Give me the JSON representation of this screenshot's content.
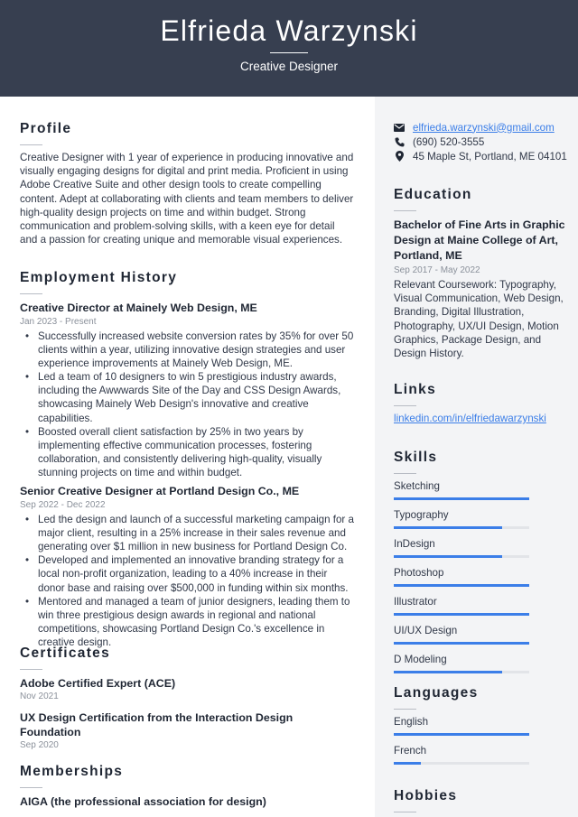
{
  "header": {
    "name": "Elfrieda Warzynski",
    "title": "Creative Designer"
  },
  "profile": {
    "heading": "Profile",
    "text": "Creative Designer with 1 year of experience in producing innovative and visually engaging designs for digital and print media. Proficient in using Adobe Creative Suite and other design tools to create compelling content. Adept at collaborating with clients and team members to deliver high-quality design projects on time and within budget. Strong communication and problem-solving skills, with a keen eye for detail and a passion for creating unique and memorable visual experiences."
  },
  "employment": {
    "heading": "Employment History",
    "jobs": [
      {
        "title": "Creative Director at Mainely Web Design, ME",
        "date": "Jan 2023 - Present",
        "bullets": [
          "Successfully increased website conversion rates by 35% for over 50 clients within a year, utilizing innovative design strategies and user experience improvements at Mainely Web Design, ME.",
          "Led a team of 10 designers to win 5 prestigious industry awards, including the Awwwards Site of the Day and CSS Design Awards, showcasing Mainely Web Design's innovative and creative capabilities.",
          "Boosted overall client satisfaction by 25% in two years by implementing effective communication processes, fostering collaboration, and consistently delivering high-quality, visually stunning projects on time and within budget."
        ]
      },
      {
        "title": "Senior Creative Designer at Portland Design Co., ME",
        "date": "Sep 2022 - Dec 2022",
        "bullets": [
          "Led the design and launch of a successful marketing campaign for a major client, resulting in a 25% increase in their sales revenue and generating over $1 million in new business for Portland Design Co.",
          "Developed and implemented an innovative branding strategy for a local non-profit organization, leading to a 40% increase in their donor base and raising over $500,000 in funding within six months.",
          "Mentored and managed a team of junior designers, leading them to win three prestigious design awards in regional and national competitions, showcasing Portland Design Co.'s excellence in creative design."
        ]
      }
    ]
  },
  "certificates": {
    "heading": "Certificates",
    "items": [
      {
        "title": "Adobe Certified Expert (ACE)",
        "date": "Nov 2021"
      },
      {
        "title": "UX Design Certification from the Interaction Design Foundation",
        "date": "Sep 2020"
      }
    ]
  },
  "memberships": {
    "heading": "Memberships",
    "items": [
      {
        "title": "AIGA (the professional association for design)"
      }
    ]
  },
  "contact": {
    "email": "elfrieda.warzynski@gmail.com",
    "phone": "(690) 520-3555",
    "address": "45 Maple St, Portland, ME 04101",
    "icons": {
      "email": "envelope-icon",
      "phone": "phone-icon",
      "address": "map-pin-icon"
    }
  },
  "education": {
    "heading": "Education",
    "degree": "Bachelor of Fine Arts in Graphic Design at Maine College of Art, Portland, ME",
    "date": "Sep 2017 - May 2022",
    "details": "Relevant Coursework: Typography, Visual Communication, Web Design, Branding, Digital Illustration, Photography, UX/UI Design, Motion Graphics, Package Design, and Design History."
  },
  "links": {
    "heading": "Links",
    "items": [
      {
        "label": "linkedin.com/in/elfriedawarzynski"
      }
    ]
  },
  "skills": {
    "heading": "Skills",
    "items": [
      {
        "name": "Sketching",
        "level_percent": 100
      },
      {
        "name": "Typography",
        "level_percent": 80
      },
      {
        "name": "InDesign",
        "level_percent": 80
      },
      {
        "name": "Photoshop",
        "level_percent": 100
      },
      {
        "name": "Illustrator",
        "level_percent": 100
      },
      {
        "name": "UI/UX Design",
        "level_percent": 100
      },
      {
        "name": "D Modeling",
        "level_percent": 80
      }
    ]
  },
  "languages": {
    "heading": "Languages",
    "items": [
      {
        "name": "English",
        "level_percent": 100
      },
      {
        "name": "French",
        "level_percent": 20
      }
    ]
  },
  "hobbies": {
    "heading": "Hobbies"
  },
  "colors": {
    "header_bg": "#373f50",
    "sidebar_bg": "#f3f4f6",
    "accent": "#3b7ee8",
    "text": "#303848",
    "muted": "#8a909a"
  }
}
